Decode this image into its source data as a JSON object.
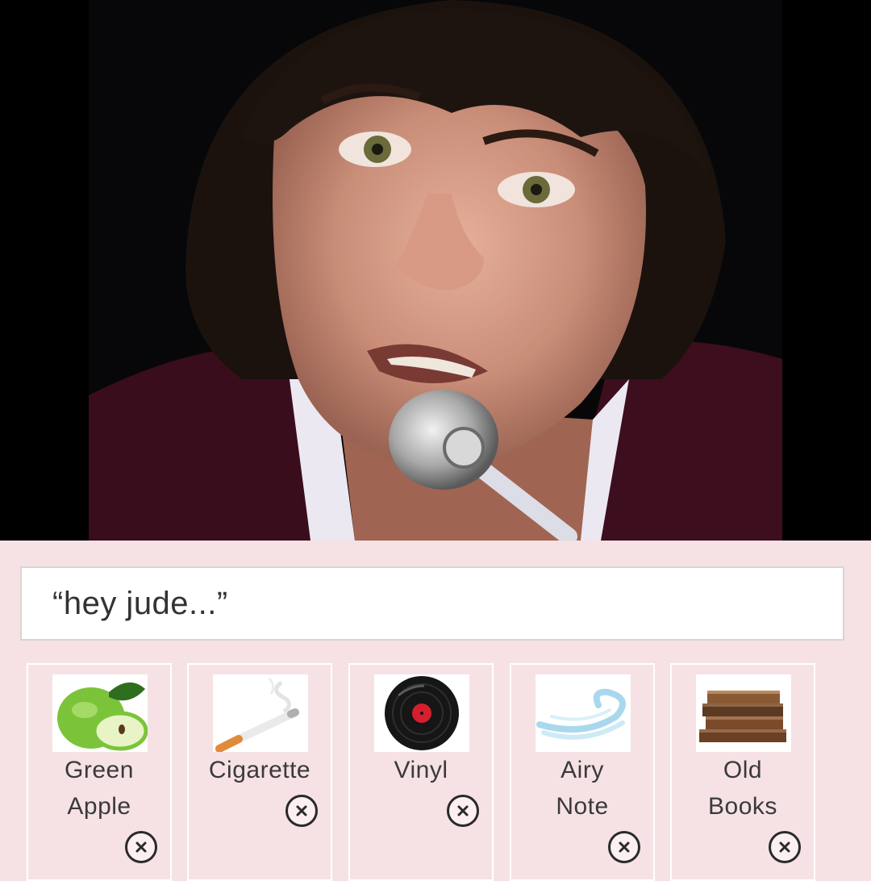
{
  "search": {
    "query": "“hey jude...”"
  },
  "items": [
    {
      "label": "Green\nApple",
      "icon": "green-apple-icon"
    },
    {
      "label": "Cigarette",
      "icon": "cigarette-icon"
    },
    {
      "label": "Vinyl",
      "icon": "vinyl-record-icon"
    },
    {
      "label": "Airy\nNote",
      "icon": "air-wave-icon"
    },
    {
      "label": "Old\nBooks",
      "icon": "old-books-icon"
    }
  ],
  "remove_icon": "close-circle-icon",
  "colors": {
    "background": "#f6e2e4",
    "card_border": "#ffffff",
    "text": "#3a3a3a"
  }
}
